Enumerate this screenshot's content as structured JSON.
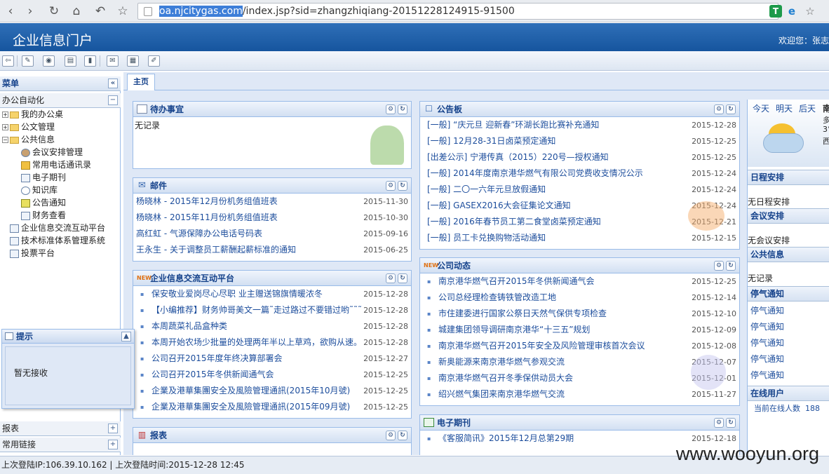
{
  "browser": {
    "url_highlight": "oa.njcitygas.com",
    "url_rest": "/index.jsp?sid=zhangzhiqiang-20151228124915-91500",
    "nav": [
      "‹",
      "›",
      "↻",
      "⌂",
      "↶",
      "☆"
    ],
    "ext_star": "☆"
  },
  "app": {
    "title": "企业信息门户",
    "welcome": "欢迎您：张志"
  },
  "toolbar": {
    "icons": [
      "exit-icon",
      "notes-icon",
      "contacts-icon",
      "print-icon",
      "tools-icon",
      "mail-icon",
      "calendar-icon",
      "edit-icon"
    ]
  },
  "sidebar": {
    "menu_title": "菜单",
    "collapse": "«",
    "group_title": "办公自动化",
    "group_btn": "−",
    "items": [
      {
        "label": "我的办公桌"
      },
      {
        "label": "公文管理"
      },
      {
        "label": "公共信息"
      },
      {
        "label": "会议安排管理"
      },
      {
        "label": "常用电话通讯录"
      },
      {
        "label": "电子期刊"
      },
      {
        "label": "知识库"
      },
      {
        "label": "公告通知"
      },
      {
        "label": "财务查看"
      },
      {
        "label": "企业信息交流互动平台"
      },
      {
        "label": "技术标准体系管理系统"
      },
      {
        "label": "投票平台"
      }
    ],
    "tip_title": "提示",
    "tip_text": "暂无接收",
    "tip_btn": "▲",
    "report": "报表",
    "links": "常用链接",
    "plus": "+"
  },
  "tabs": {
    "main": "主页"
  },
  "todo": {
    "title": "待办事宜",
    "empty": "无记录"
  },
  "mail": {
    "title": "邮件",
    "rows": [
      {
        "t": "杨晓林 - 2015年12月份机务组值班表",
        "d": "2015-11-30"
      },
      {
        "t": "杨晓林 - 2015年11月份机务组值班表",
        "d": "2015-10-30"
      },
      {
        "t": "高红虹 - 气源保障办公电话号码表",
        "d": "2015-09-16"
      },
      {
        "t": "王永生 - 关于调整员工薪酬起薪标准的通知",
        "d": "2015-06-25"
      }
    ]
  },
  "forum": {
    "title": "企业信息交流互动平台",
    "rows": [
      {
        "t": "保安敬业爱岗尽心尽职 业主赠送锦旗情暖浓冬",
        "d": "2015-12-28"
      },
      {
        "t": "【小编推荐】财务帅哥美文一篇˜走过路过不要错过哟˜˜˜",
        "d": "2015-12-28"
      },
      {
        "t": "本周蔬菜礼品盒种类",
        "d": "2015-12-28"
      },
      {
        "t": "本周开始农场少批量的处理两年半以上草鸡，欲购从速。",
        "d": "2015-12-28"
      },
      {
        "t": "公司召开2015年度年终决算部署会",
        "d": "2015-12-27"
      },
      {
        "t": "公司召开2015年冬供新闻通气会",
        "d": "2015-12-25"
      },
      {
        "t": "企業及港華集團安全及風險管理通訊(2015年10月號)",
        "d": "2015-12-25"
      },
      {
        "t": "企業及港華集團安全及風險管理通訊(2015年09月號)",
        "d": "2015-12-25"
      }
    ]
  },
  "report": {
    "title": "报表"
  },
  "board": {
    "title": "公告板",
    "rows": [
      {
        "t": "[一般] “庆元旦 迎新春”环湖长跑比赛补充通知",
        "d": "2015-12-28"
      },
      {
        "t": "[一般] 12月28-31日卤菜预定通知",
        "d": "2015-12-25"
      },
      {
        "t": "[出差公示] 宁港传真（2015）220号—授权通知",
        "d": "2015-12-25"
      },
      {
        "t": "[一般] 2014年度南京港华燃气有限公司党费收支情况公示",
        "d": "2015-12-24"
      },
      {
        "t": "[一般] 二〇一六年元旦放假通知",
        "d": "2015-12-24"
      },
      {
        "t": "[一般] GASEX2016大会征集论文通知",
        "d": "2015-12-24"
      },
      {
        "t": "[一般] 2016年春节员工第二食堂卤菜预定通知",
        "d": "2015-12-21"
      },
      {
        "t": "[一般] 员工卡兑换购物活动通知",
        "d": "2015-12-15"
      }
    ]
  },
  "news": {
    "title": "公司动态",
    "rows": [
      {
        "t": "南京港华燃气召开2015年冬供新闻通气会",
        "d": "2015-12-25"
      },
      {
        "t": "公司总经理检查铸铁管改造工地",
        "d": "2015-12-14"
      },
      {
        "t": "市住建委进行国家公祭日天然气保供专项检查",
        "d": "2015-12-10"
      },
      {
        "t": "城建集团领导调研南京港华“十三五”规划",
        "d": "2015-12-09"
      },
      {
        "t": "南京港华燃气召开2015年安全及风险管理审核首次会议",
        "d": "2015-12-08"
      },
      {
        "t": "新奥能源来南京港华燃气参观交流",
        "d": "2015-12-07"
      },
      {
        "t": "南京港华燃气召开冬季保供动员大会",
        "d": "2015-12-01"
      },
      {
        "t": "绍兴燃气集团来南京港华燃气交流",
        "d": "2015-11-27"
      }
    ]
  },
  "journal": {
    "title": "电子期刊",
    "rows": [
      {
        "t": "《客服简讯》2015年12月总第29期",
        "d": "2015-12-18"
      }
    ]
  },
  "weather": {
    "today": "今天",
    "tomorrow": "明天",
    "after": "后天",
    "city": "南",
    "line2": "多",
    "line3": "3°",
    "line4": "西"
  },
  "right": {
    "schedule": "日程安排",
    "schedule_empty": "无日程安排",
    "meeting": "会议安排",
    "meeting_empty": "无会议安排",
    "public": "公共信息",
    "public_empty": "无记录",
    "outage": "停气通知",
    "outage_items": [
      "停气通知",
      "停气通知",
      "停气通知",
      "停气通知",
      "停气通知"
    ],
    "online": "在线用户",
    "online_label": "当前在线人数",
    "online_count": "188"
  },
  "status": {
    "text": "上次登陆IP:106.39.10.162 | 上次登陆时间:2015-12-28 12:45"
  },
  "watermark": "www.wooyun.org",
  "colors": {
    "brand": "#1f5fa8",
    "link": "#1c4d9c",
    "panel_border": "#99bbe8"
  }
}
